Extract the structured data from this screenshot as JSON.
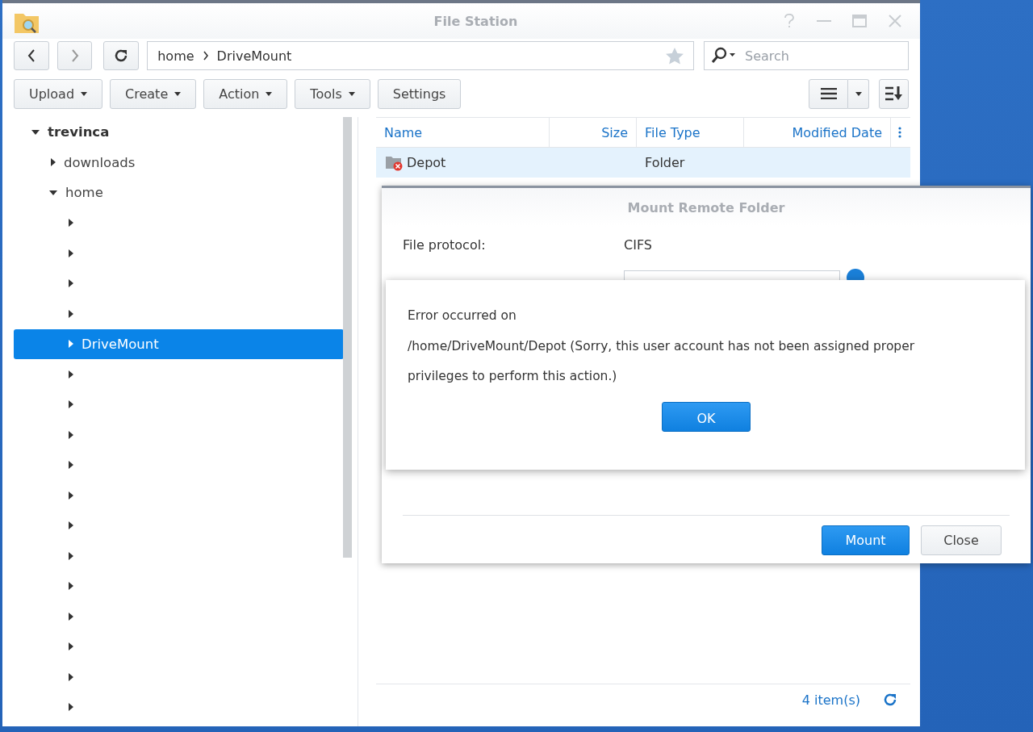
{
  "window": {
    "title": "File Station"
  },
  "nav": {
    "path": [
      "home",
      "DriveMount"
    ],
    "search": {
      "placeholder": "Search"
    }
  },
  "toolbar": [
    {
      "label": "Upload",
      "dropdown": true
    },
    {
      "label": "Create",
      "dropdown": true
    },
    {
      "label": "Action",
      "dropdown": true
    },
    {
      "label": "Tools",
      "dropdown": true
    },
    {
      "label": "Settings",
      "dropdown": false
    }
  ],
  "tree": [
    {
      "label": "trevinca",
      "expanded": true,
      "selected": false,
      "children": [
        {
          "label": "downloads",
          "expanded": false,
          "selected": false
        },
        {
          "label": "home",
          "expanded": true,
          "selected": false,
          "children": [
            {
              "expanded": false,
              "selected": false
            },
            {
              "expanded": false,
              "selected": false
            },
            {
              "expanded": false,
              "selected": false
            },
            {
              "expanded": false,
              "selected": false
            },
            {
              "label": "DriveMount",
              "expanded": false,
              "selected": true
            },
            {
              "expanded": false,
              "selected": false
            },
            {
              "expanded": false,
              "selected": false
            },
            {
              "expanded": false,
              "selected": false
            },
            {
              "expanded": false,
              "selected": false
            },
            {
              "expanded": false,
              "selected": false
            },
            {
              "expanded": false,
              "selected": false
            },
            {
              "expanded": false,
              "selected": false
            },
            {
              "expanded": false,
              "selected": false
            },
            {
              "expanded": false,
              "selected": false
            },
            {
              "expanded": false,
              "selected": false
            },
            {
              "expanded": false,
              "selected": false
            },
            {
              "expanded": false,
              "selected": false
            }
          ]
        }
      ]
    }
  ],
  "table": {
    "columns": [
      "Name",
      "Size",
      "File Type",
      "Modified Date"
    ],
    "rows": [
      {
        "name": "Depot",
        "file_type": "Folder",
        "error": true,
        "selected": true
      }
    ]
  },
  "footer": {
    "count": "4 item(s)"
  },
  "mount_dialog": {
    "title": "Mount Remote Folder",
    "fields": [
      {
        "label": "File protocol:",
        "kind": "text",
        "value": "CIFS"
      },
      {
        "kind": "input"
      }
    ],
    "buttons": [
      {
        "label": "Mount",
        "primary": true
      },
      {
        "label": "Close",
        "primary": false
      }
    ]
  },
  "error_dialog": {
    "heading": "Error occurred on",
    "message": "/home/DriveMount/Depot (Sorry, this user account has not been assigned proper privileges to perform this action.)",
    "button": "OK"
  }
}
